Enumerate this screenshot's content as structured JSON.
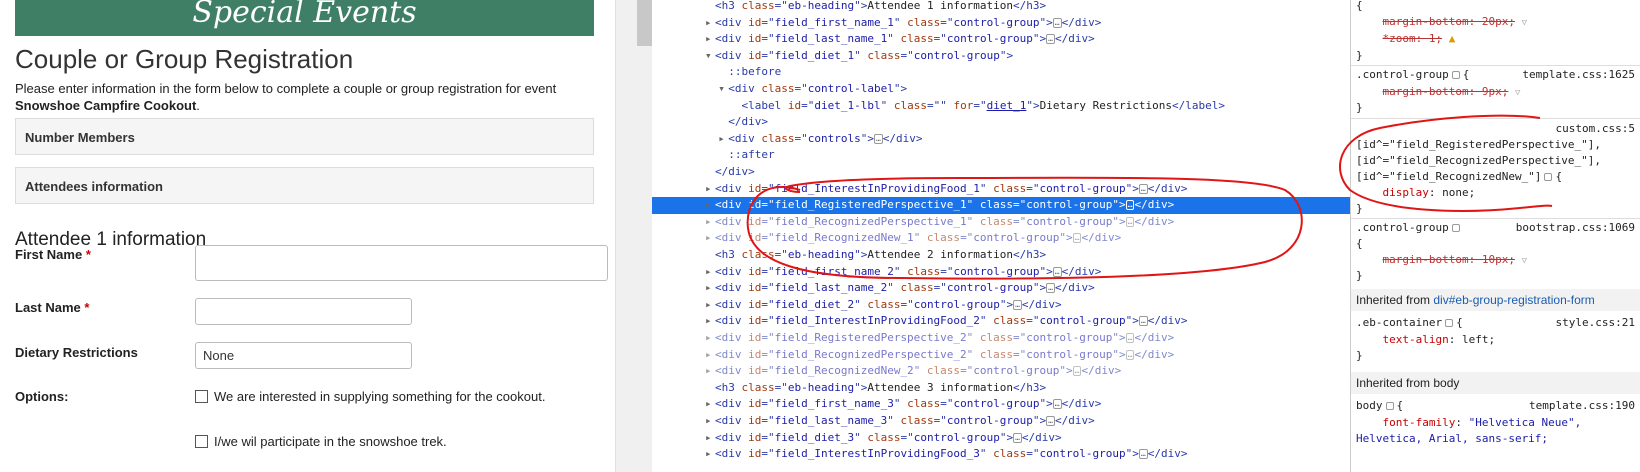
{
  "page": {
    "banner": "Special Events",
    "title": "Couple or Group Registration",
    "intro_text": "Please enter information in the form below to complete a couple or group registration for event",
    "event_name": "Snowshoe Campfire Cookout",
    "intro_end": ".",
    "panel_number_members": "Number Members",
    "panel_attendees": "Attendees information",
    "attendee_heading": "Attendee 1 information",
    "first_name_label": "First Name",
    "last_name_label": "Last Name",
    "required_mark": "*",
    "dietary_label": "Dietary Restrictions",
    "dietary_value": "None",
    "options_label": "Options:",
    "option_1": "We are interested in supplying something for the cookout.",
    "option_2": "I/we wil participate in the snowshoe trek."
  },
  "dom_lines": [
    {
      "indent": 8,
      "tw": "",
      "tag": "h3",
      "attrs": [
        [
          "class",
          "eb-heading"
        ]
      ],
      "text": "Attendee 1 information",
      "close": "h3"
    },
    {
      "indent": 8,
      "tw": "▶",
      "tag": "div",
      "attrs": [
        [
          "id",
          "field_first_name_1"
        ],
        [
          "class",
          "control-group"
        ]
      ],
      "ellipsis": true,
      "close": "div"
    },
    {
      "indent": 8,
      "tw": "▶",
      "tag": "div",
      "attrs": [
        [
          "id",
          "field_last_name_1"
        ],
        [
          "class",
          "control-group"
        ]
      ],
      "ellipsis": true,
      "close": "div"
    },
    {
      "indent": 8,
      "tw": "▼",
      "tag": "div",
      "attrs": [
        [
          "id",
          "field_diet_1"
        ],
        [
          "class",
          "control-group"
        ]
      ],
      "open": true
    },
    {
      "indent": 10,
      "tw": "",
      "pseudo": "::before"
    },
    {
      "indent": 10,
      "tw": "▼",
      "tag": "div",
      "attrs": [
        [
          "class",
          "control-label"
        ]
      ],
      "open": true
    },
    {
      "indent": 12,
      "tw": "",
      "tag": "label",
      "attrs": [
        [
          "id",
          "diet_1-lbl"
        ],
        [
          "class",
          ""
        ],
        [
          "for",
          "diet_1"
        ]
      ],
      "text": "Dietary Restrictions",
      "close": "label",
      "link_attr": "for"
    },
    {
      "indent": 10,
      "tw": "",
      "closeonly": "div"
    },
    {
      "indent": 10,
      "tw": "▶",
      "tag": "div",
      "attrs": [
        [
          "class",
          "controls"
        ]
      ],
      "ellipsis": true,
      "close": "div"
    },
    {
      "indent": 10,
      "tw": "",
      "pseudo": "::after"
    },
    {
      "indent": 8,
      "tw": "",
      "closeonly": "div"
    },
    {
      "indent": 8,
      "tw": "▶",
      "tag": "div",
      "attrs": [
        [
          "id",
          "field_InterestInProvidingFood_1"
        ],
        [
          "class",
          "control-group"
        ]
      ],
      "ellipsis": true,
      "close": "div"
    },
    {
      "indent": 8,
      "tw": "▶",
      "tag": "div",
      "attrs": [
        [
          "id",
          "field_RegisteredPerspective_1"
        ],
        [
          "class",
          "control-group"
        ]
      ],
      "ellipsis": true,
      "close": "div",
      "selected": true
    },
    {
      "indent": 8,
      "tw": "▶",
      "tag": "div",
      "attrs": [
        [
          "id",
          "field_RecognizedPerspective_1"
        ],
        [
          "class",
          "control-group"
        ]
      ],
      "ellipsis": true,
      "close": "div",
      "dim": true
    },
    {
      "indent": 8,
      "tw": "▶",
      "tag": "div",
      "attrs": [
        [
          "id",
          "field_RecognizedNew_1"
        ],
        [
          "class",
          "control-group"
        ]
      ],
      "ellipsis": true,
      "close": "div",
      "dim": true
    },
    {
      "indent": 8,
      "tw": "",
      "tag": "h3",
      "attrs": [
        [
          "class",
          "eb-heading"
        ]
      ],
      "text": "Attendee 2 information",
      "close": "h3"
    },
    {
      "indent": 8,
      "tw": "▶",
      "tag": "div",
      "attrs": [
        [
          "id",
          "field_first_name_2"
        ],
        [
          "class",
          "control-group"
        ]
      ],
      "ellipsis": true,
      "close": "div"
    },
    {
      "indent": 8,
      "tw": "▶",
      "tag": "div",
      "attrs": [
        [
          "id",
          "field_last_name_2"
        ],
        [
          "class",
          "control-group"
        ]
      ],
      "ellipsis": true,
      "close": "div"
    },
    {
      "indent": 8,
      "tw": "▶",
      "tag": "div",
      "attrs": [
        [
          "id",
          "field_diet_2"
        ],
        [
          "class",
          "control-group"
        ]
      ],
      "ellipsis": true,
      "close": "div"
    },
    {
      "indent": 8,
      "tw": "▶",
      "tag": "div",
      "attrs": [
        [
          "id",
          "field_InterestInProvidingFood_2"
        ],
        [
          "class",
          "control-group"
        ]
      ],
      "ellipsis": true,
      "close": "div"
    },
    {
      "indent": 8,
      "tw": "▶",
      "tag": "div",
      "attrs": [
        [
          "id",
          "field_RegisteredPerspective_2"
        ],
        [
          "class",
          "control-group"
        ]
      ],
      "ellipsis": true,
      "close": "div",
      "dim": true
    },
    {
      "indent": 8,
      "tw": "▶",
      "tag": "div",
      "attrs": [
        [
          "id",
          "field_RecognizedPerspective_2"
        ],
        [
          "class",
          "control-group"
        ]
      ],
      "ellipsis": true,
      "close": "div",
      "dim": true
    },
    {
      "indent": 8,
      "tw": "▶",
      "tag": "div",
      "attrs": [
        [
          "id",
          "field_RecognizedNew_2"
        ],
        [
          "class",
          "control-group"
        ]
      ],
      "ellipsis": true,
      "close": "div",
      "dim": true
    },
    {
      "indent": 8,
      "tw": "",
      "tag": "h3",
      "attrs": [
        [
          "class",
          "eb-heading"
        ]
      ],
      "text": "Attendee 3 information",
      "close": "h3"
    },
    {
      "indent": 8,
      "tw": "▶",
      "tag": "div",
      "attrs": [
        [
          "id",
          "field_first_name_3"
        ],
        [
          "class",
          "control-group"
        ]
      ],
      "ellipsis": true,
      "close": "div"
    },
    {
      "indent": 8,
      "tw": "▶",
      "tag": "div",
      "attrs": [
        [
          "id",
          "field_last_name_3"
        ],
        [
          "class",
          "control-group"
        ]
      ],
      "ellipsis": true,
      "close": "div"
    },
    {
      "indent": 8,
      "tw": "▶",
      "tag": "div",
      "attrs": [
        [
          "id",
          "field_diet_3"
        ],
        [
          "class",
          "control-group"
        ]
      ],
      "ellipsis": true,
      "close": "div"
    },
    {
      "indent": 8,
      "tw": "▶",
      "tag": "div",
      "attrs": [
        [
          "id",
          "field_InterestInProvidingFood_3"
        ],
        [
          "class",
          "control-group"
        ]
      ],
      "ellipsis": true,
      "close": "div"
    }
  ],
  "styles": {
    "open_brace": "{",
    "close_brace": "}",
    "r0_p1": "margin-bottom: 20px;",
    "r0_p2": "*zoom: 1;",
    "r1_selector": ".control-group",
    "r1_source": "template.css:1625",
    "r1_p1": "margin-bottom: 9px;",
    "r2_source": "custom.css:5",
    "r2_sel1": "[id^=\"field_RegisteredPerspective_\"],",
    "r2_sel2": "[id^=\"field_RecognizedPerspective_\"],",
    "r2_sel3": "[id^=\"field_RecognizedNew_\"]",
    "r2_prop": "display",
    "r2_val": "none;",
    "r3_selector": ".control-group",
    "r3_source": "bootstrap.css:1069",
    "r3_p1": "margin-bottom: 10px;",
    "inherited1_prefix": "Inherited from ",
    "inherited1_target": "div#eb-group-registration-form",
    "r4_selector": ".eb-container",
    "r4_source": "style.css:21",
    "r4_prop": "text-align",
    "r4_val": "left;",
    "inherited2_prefix": "Inherited from ",
    "inherited2_target": "body",
    "r5_selector": "body",
    "r5_source": "template.css:190",
    "r5_prop": "font-family",
    "r5_val": "\"Helvetica Neue\",",
    "r5_val2": "Helvetica, Arial, sans-serif;"
  },
  "colors": {
    "banner": "#3f7f65",
    "selection": "#1a73e8",
    "annotation": "#e01515"
  }
}
